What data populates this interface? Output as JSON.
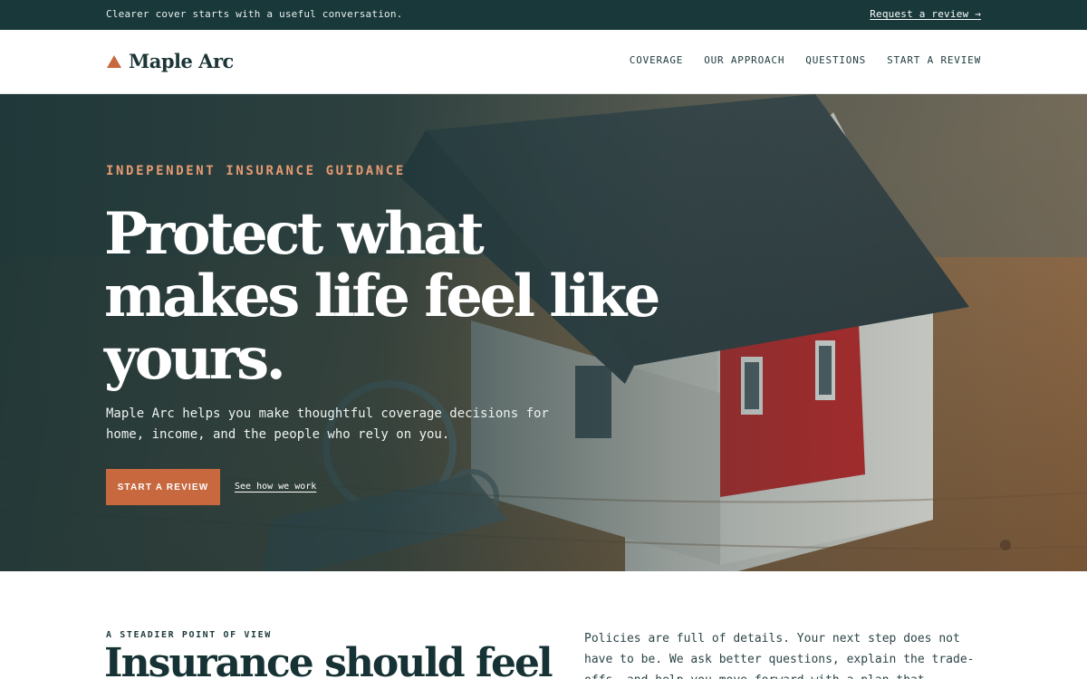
{
  "topbar": {
    "message": "Clearer cover starts with a useful conversation.",
    "link": "Request a review →"
  },
  "brand": {
    "name": "Maple Arc",
    "logo_icon": "triangle-mark-icon",
    "accent": "#c8683f",
    "dark": "#18383a"
  },
  "nav": {
    "items": [
      {
        "label": "COVERAGE"
      },
      {
        "label": "OUR APPROACH"
      },
      {
        "label": "QUESTIONS"
      },
      {
        "label": "START A REVIEW"
      }
    ]
  },
  "hero": {
    "eyebrow": "INDEPENDENT INSURANCE GUIDANCE",
    "headline": "Protect what makes life feel like yours.",
    "subtext": "Maple Arc helps you make thoughtful coverage decisions for home, income, and the people who rely on you.",
    "primary_cta": "START A REVIEW",
    "secondary_link": "See how we work",
    "image": "model-house-with-keys-photo"
  },
  "intro": {
    "eyebrow": "A STEADIER POINT OF VIEW",
    "title": "Insurance should feel",
    "body": "Policies are full of details. Your next step does not have to be. We ask better questions, explain the trade-offs, and help you move forward with a plan that"
  }
}
